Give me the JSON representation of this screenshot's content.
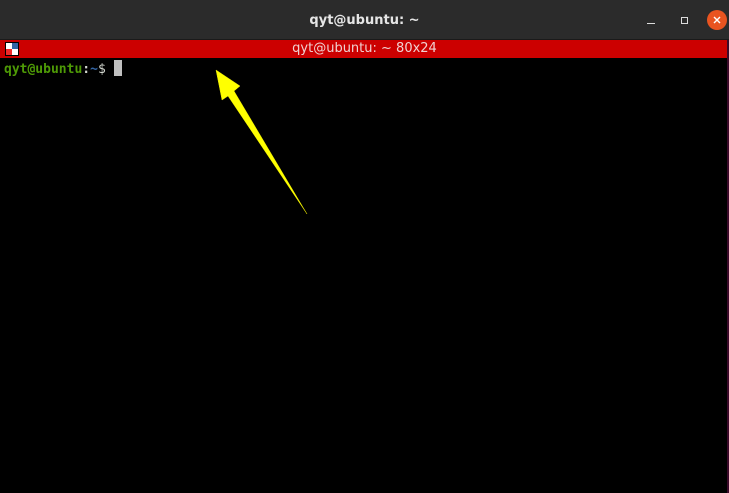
{
  "window": {
    "title": "qyt@ubuntu: ~"
  },
  "infobar": {
    "text": "qyt@ubuntu: ~ 80x24"
  },
  "terminal": {
    "prompt_user_host": "qyt@ubuntu",
    "prompt_colon": ":",
    "prompt_path": "~",
    "prompt_symbol": "$"
  },
  "colors": {
    "titlebar": "#2b2b2b",
    "infobar": "#cc0000",
    "terminal_bg": "#000000",
    "prompt_user": "#4e9a06",
    "prompt_path": "#3465a4",
    "close_button": "#e95420",
    "annotation_arrow": "#ffff00"
  },
  "icons": {
    "minimize": "minimize-icon",
    "maximize": "maximize-icon",
    "close": "close-icon",
    "terminal_app": "terminal-app-icon",
    "annotation": "arrow-annotation-icon"
  }
}
